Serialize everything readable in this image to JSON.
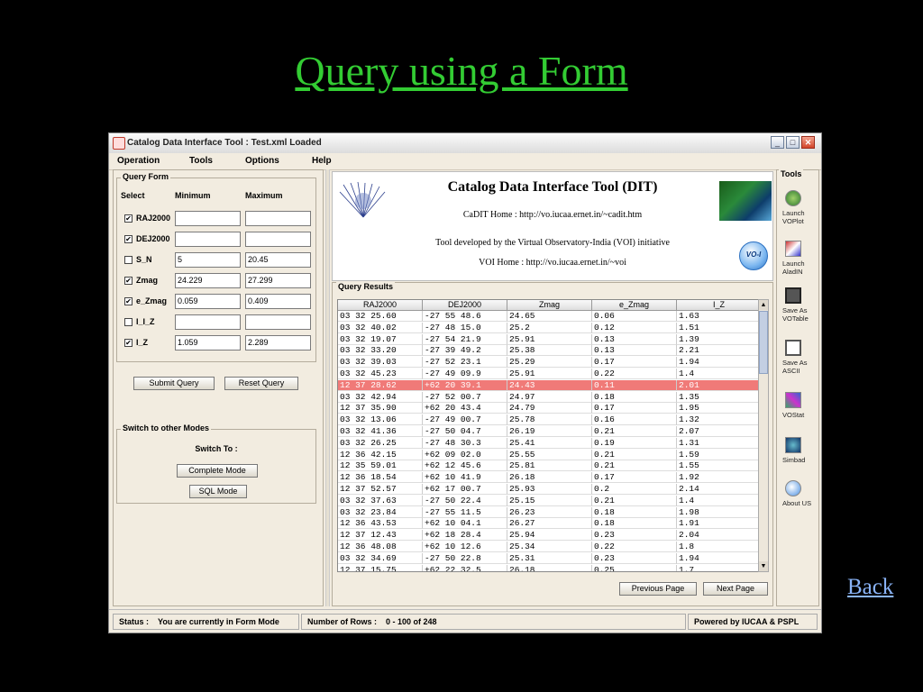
{
  "slide": {
    "title": "Query using a Form",
    "back_link": "Back"
  },
  "window": {
    "title": "Catalog Data Interface Tool : Test.xml Loaded",
    "menu": [
      "Operation",
      "Tools",
      "Options",
      "Help"
    ]
  },
  "query_form": {
    "group_label": "Query Form",
    "col_select": "Select",
    "col_min": "Minimum",
    "col_max": "Maximum",
    "rows": [
      {
        "label": "RAJ2000",
        "checked": true,
        "min": "",
        "max": ""
      },
      {
        "label": "DEJ2000",
        "checked": true,
        "min": "",
        "max": ""
      },
      {
        "label": "S_N",
        "checked": false,
        "min": "5",
        "max": "20.45"
      },
      {
        "label": "Zmag",
        "checked": true,
        "min": "24.229",
        "max": "27.299"
      },
      {
        "label": "e_Zmag",
        "checked": true,
        "min": "0.059",
        "max": "0.409"
      },
      {
        "label": "I_I_Z",
        "checked": false,
        "min": "",
        "max": ""
      },
      {
        "label": "I_Z",
        "checked": true,
        "min": "1.059",
        "max": "2.289"
      }
    ],
    "submit_label": "Submit Query",
    "reset_label": "Reset Query"
  },
  "modes": {
    "group_label": "Switch to other Modes",
    "switch_to": "Switch To :",
    "complete_mode": "Complete Mode",
    "sql_mode": "SQL Mode"
  },
  "info": {
    "title": "Catalog Data Interface Tool (DIT)",
    "cadit_home": "CaDIT Home : http://vo.iucaa.ernet.in/~cadit.htm",
    "developed_by": "Tool developed by the Virtual Observatory-India (VOI) initiative",
    "voi_home": "VOI Home : http://vo.iucaa.ernet.in/~voi",
    "voi_logo_text": "VO-I"
  },
  "results": {
    "group_label": "Query Results",
    "columns": [
      "RAJ2000",
      "DEJ2000",
      "Zmag",
      "e_Zmag",
      "I_Z"
    ],
    "selected_row": 6,
    "rows": [
      [
        "03 32 25.60",
        "-27 55 48.6",
        "24.65",
        "0.06",
        "1.63"
      ],
      [
        "03 32 40.02",
        "-27 48 15.0",
        "25.2",
        "0.12",
        "1.51"
      ],
      [
        "03 32 19.07",
        "-27 54 21.9",
        "25.91",
        "0.13",
        "1.39"
      ],
      [
        "03 32 33.20",
        "-27 39 49.2",
        "25.38",
        "0.13",
        "2.21"
      ],
      [
        "03 32 39.03",
        "-27 52 23.1",
        "25.29",
        "0.17",
        "1.94"
      ],
      [
        "03 32 45.23",
        "-27 49 09.9",
        "25.91",
        "0.22",
        "1.4"
      ],
      [
        "12 37 28.62",
        "+62 20 39.1",
        "24.43",
        "0.11",
        "2.01"
      ],
      [
        "03 32 42.94",
        "-27 52 00.7",
        "24.97",
        "0.18",
        "1.35"
      ],
      [
        "12 37 35.90",
        "+62 20 43.4",
        "24.79",
        "0.17",
        "1.95"
      ],
      [
        "03 32 13.06",
        "-27 49 00.7",
        "25.78",
        "0.16",
        "1.32"
      ],
      [
        "03 32 41.36",
        "-27 50 04.7",
        "26.19",
        "0.21",
        "2.07"
      ],
      [
        "03 32 26.25",
        "-27 48 30.3",
        "25.41",
        "0.19",
        "1.31"
      ],
      [
        "12 36 42.15",
        "+62 09 02.0",
        "25.55",
        "0.21",
        "1.59"
      ],
      [
        "12 35 59.01",
        "+62 12 45.6",
        "25.81",
        "0.21",
        "1.55"
      ],
      [
        "12 36 18.54",
        "+62 10 41.9",
        "26.18",
        "0.17",
        "1.92"
      ],
      [
        "12 37 52.57",
        "+62 17 00.7",
        "25.93",
        "0.2",
        "2.14"
      ],
      [
        "03 32 37.63",
        "-27 50 22.4",
        "25.15",
        "0.21",
        "1.4"
      ],
      [
        "03 32 23.84",
        "-27 55 11.5",
        "26.23",
        "0.18",
        "1.98"
      ],
      [
        "12 36 43.53",
        "+62 10 04.1",
        "26.27",
        "0.18",
        "1.91"
      ],
      [
        "12 37 12.43",
        "+62 18 28.4",
        "25.94",
        "0.23",
        "2.04"
      ],
      [
        "12 36 48.08",
        "+62 10 12.6",
        "25.34",
        "0.22",
        "1.8"
      ],
      [
        "03 32 34.69",
        "-27 50 22.8",
        "25.31",
        "0.23",
        "1.94"
      ],
      [
        "12 37 15.75",
        "+62 22 32.5",
        "26.18",
        "0.25",
        "1.7"
      ]
    ],
    "prev_label": "Previous Page",
    "next_label": "Next Page"
  },
  "tools": {
    "group_label": "Tools",
    "items": [
      {
        "label": "Launch VOPlot",
        "icon": "voplot-icon"
      },
      {
        "label": "Launch AladIN",
        "icon": "aladin-icon"
      },
      {
        "label": "Save As VOTable",
        "icon": "floppy-disk-icon"
      },
      {
        "label": "Save As ASCII",
        "icon": "floppy-disk-icon"
      },
      {
        "label": "VOStat",
        "icon": "vostat-icon"
      },
      {
        "label": "Simbad",
        "icon": "simbad-icon"
      },
      {
        "label": "About US",
        "icon": "info-icon"
      }
    ]
  },
  "status": {
    "status_label": "Status :",
    "status_value": "You are currently in Form Mode",
    "rows_label": "Number of Rows :",
    "rows_value": "0 - 100 of 248",
    "powered_by": "Powered by IUCAA & PSPL"
  }
}
